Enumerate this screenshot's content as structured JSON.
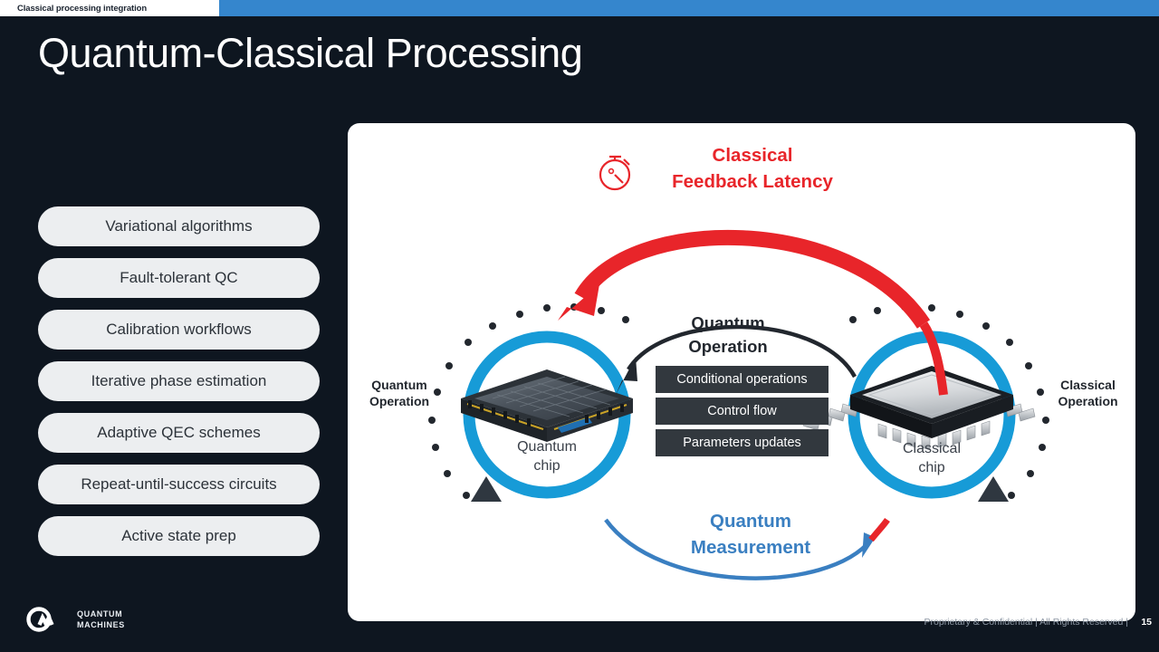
{
  "topbar": {
    "tab_label": "Classical processing integration",
    "bar_color": "#3586cd"
  },
  "slide": {
    "title": "Quantum-Classical Processing",
    "background_color": "#0e1620"
  },
  "sidebar": {
    "items": [
      {
        "label": "Variational algorithms"
      },
      {
        "label": "Fault-tolerant QC"
      },
      {
        "label": "Calibration workflows"
      },
      {
        "label": "Iterative phase estimation"
      },
      {
        "label": "Adaptive QEC schemes"
      },
      {
        "label": "Repeat-until-success circuits"
      },
      {
        "label": "Active state prep"
      }
    ]
  },
  "diagram": {
    "latency_title_line1": "Classical",
    "latency_title_line2": "Feedback Latency",
    "latency_color": "#e8252a",
    "stopwatch_icon": "stopwatch-icon",
    "center_title_line1": "Quantum",
    "center_title_line2": "Operation",
    "operation_boxes": [
      {
        "label": "Conditional operations"
      },
      {
        "label": "Control flow"
      },
      {
        "label": "Parameters updates"
      }
    ],
    "measurement_title_line1": "Quantum",
    "measurement_title_line2": "Measurement",
    "measurement_color": "#3a7fc1",
    "left_side_label_line1": "Quantum",
    "left_side_label_line2": "Operation",
    "right_side_label_line1": "Classical",
    "right_side_label_line2": "Operation",
    "left_chip_label_line1": "Quantum",
    "left_chip_label_line2": "chip",
    "right_chip_label_line1": "Classical",
    "right_chip_label_line2": "chip",
    "circle_color": "#179bd7",
    "arc_color": "#22272e",
    "card_color": "#ffffff"
  },
  "footer": {
    "logo_line1": "QUANTUM",
    "logo_line2": "MACHINES",
    "note": "Proprietary & Confidential | All Rights Reserved  |",
    "page": "15"
  }
}
